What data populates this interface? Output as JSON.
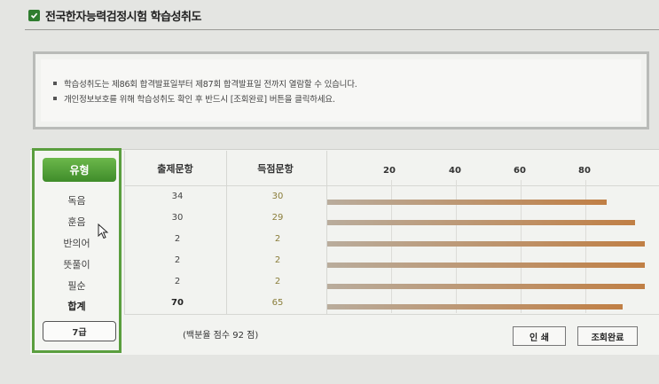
{
  "title": "전국한자능력검정시험 학습성취도",
  "notice": [
    "학습성취도는 제86회 합격발표일부터 제87회 합격발표일 전까지 열람할 수 있습니다.",
    "개인정보보호를 위해 학습성취도 확인 후 반드시 [조회완료] 버튼을 클릭하세요."
  ],
  "table": {
    "type_header": "유형",
    "col_questions": "출제문항",
    "col_correct": "득점문항",
    "axis_ticks": [
      "20",
      "40",
      "60",
      "80"
    ],
    "rows": [
      {
        "type": "독음",
        "questions": "34",
        "correct": "30",
        "percent": 88
      },
      {
        "type": "훈음",
        "questions": "30",
        "correct": "29",
        "percent": 97
      },
      {
        "type": "반의어",
        "questions": "2",
        "correct": "2",
        "percent": 100
      },
      {
        "type": "뜻풀이",
        "questions": "2",
        "correct": "2",
        "percent": 100
      },
      {
        "type": "필순",
        "questions": "2",
        "correct": "2",
        "percent": 100
      }
    ],
    "total": {
      "type": "합계",
      "questions": "70",
      "correct": "65",
      "percent": 93
    }
  },
  "level": "7급",
  "score_text": "(백분율 점수 92 점)",
  "buttons": {
    "print": "인 쇄",
    "done": "조회완료"
  },
  "colors": {
    "accent": "#5a9e3e",
    "bar_start": "#b9ac9c",
    "bar_end": "#c07f45"
  }
}
